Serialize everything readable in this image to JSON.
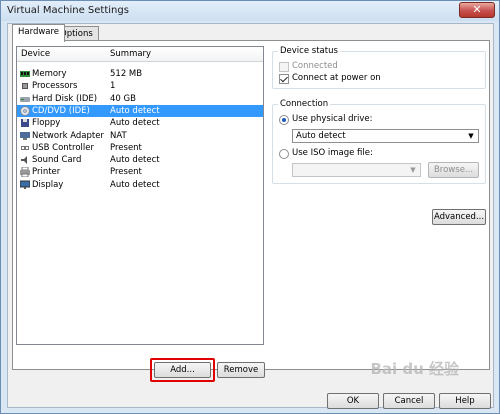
{
  "window": {
    "title": "Virtual Machine Settings",
    "close_glyph": "✕"
  },
  "tabs": [
    {
      "label": "Hardware",
      "active": true
    },
    {
      "label": "Options",
      "active": false
    }
  ],
  "device_list": {
    "col_device": "Device",
    "col_summary": "Summary",
    "rows": [
      {
        "name": "Memory",
        "summary": "512 MB",
        "icon": "memory-icon",
        "selected": false
      },
      {
        "name": "Processors",
        "summary": "1",
        "icon": "processor-icon",
        "selected": false
      },
      {
        "name": "Hard Disk (IDE)",
        "summary": "40 GB",
        "icon": "hard-disk-icon",
        "selected": false
      },
      {
        "name": "CD/DVD (IDE)",
        "summary": "Auto detect",
        "icon": "cd-dvd-icon",
        "selected": true
      },
      {
        "name": "Floppy",
        "summary": "Auto detect",
        "icon": "floppy-icon",
        "selected": false
      },
      {
        "name": "Network Adapter",
        "summary": "NAT",
        "icon": "network-adapter-icon",
        "selected": false
      },
      {
        "name": "USB Controller",
        "summary": "Present",
        "icon": "usb-icon",
        "selected": false
      },
      {
        "name": "Sound Card",
        "summary": "Auto detect",
        "icon": "sound-card-icon",
        "selected": false
      },
      {
        "name": "Printer",
        "summary": "Present",
        "icon": "printer-icon",
        "selected": false
      },
      {
        "name": "Display",
        "summary": "Auto detect",
        "icon": "display-icon",
        "selected": false
      }
    ]
  },
  "buttons": {
    "add": "Add...",
    "remove": "Remove",
    "advanced": "Advanced...",
    "ok": "OK",
    "cancel": "Cancel",
    "help": "Help"
  },
  "device_status": {
    "title": "Device status",
    "connected": "Connected",
    "connect_at_power_on": "Connect at power on"
  },
  "connection": {
    "title": "Connection",
    "use_physical_drive": "Use physical drive:",
    "physical_drive_value": "Auto detect",
    "use_iso": "Use ISO image file:",
    "iso_value": "",
    "browse": "Browse..."
  },
  "watermark": "Bai du 经验",
  "colors": {
    "selection": "#3399ff",
    "highlight": "#e00000"
  }
}
